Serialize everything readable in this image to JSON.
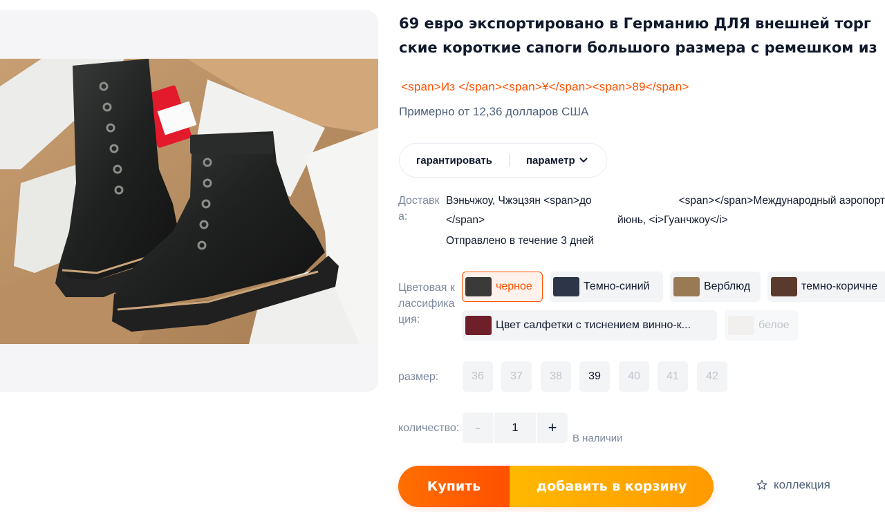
{
  "title_lines": [
    "69 евро экспортировано в Германию ДЛЯ внешней торг",
    "ские короткие сапоги большого размера с ремешком из"
  ],
  "price": "<span>Из </span><span>¥</span><span>89</span>",
  "approx_price": "Примерно от 12,36 долларов США",
  "pill": {
    "guarantee": "гарантировать",
    "params": "параметр"
  },
  "delivery": {
    "label": "Доставка:",
    "from_line1": "Вэньчжоу, Чжэцзян <span>до",
    "from_line2": "</span>",
    "to_line1": "<span></span>Международный аэропорт",
    "to_line2": "йюнь, <i>Гуанчжоу</i>",
    "shipped": "Отправлено в течение 3 дней"
  },
  "color": {
    "label": "Цветовая классификация:",
    "options": [
      {
        "label": "черное",
        "swatch": "#3a3a38",
        "state": "selected"
      },
      {
        "label": "Темно-синий",
        "swatch": "#2c3648",
        "state": "normal"
      },
      {
        "label": "Верблюд",
        "swatch": "#9a7a55",
        "state": "normal"
      },
      {
        "label": "темно-коричне",
        "swatch": "#5a3a2c",
        "state": "normal"
      },
      {
        "label": "Цвет салфетки с тиснением винно-к...",
        "swatch": "#6e1f2a",
        "state": "normal"
      },
      {
        "label": "белое",
        "swatch": "#e8e2d8",
        "state": "disabled"
      }
    ]
  },
  "size": {
    "label": "размер:",
    "values": [
      "36",
      "37",
      "38",
      "39",
      "40",
      "41",
      "42"
    ],
    "available": [
      "39"
    ]
  },
  "quantity": {
    "label": "количество:",
    "value": "1",
    "minus": "-",
    "plus": "+",
    "stock": "В наличии"
  },
  "buttons": {
    "buy": "Купить",
    "cart": "добавить в корзину",
    "collection": "коллекция"
  },
  "colors": {
    "accent": "#ff5000",
    "cart": "#ffa700",
    "text": "#11192d",
    "muted": "#7c889c"
  }
}
